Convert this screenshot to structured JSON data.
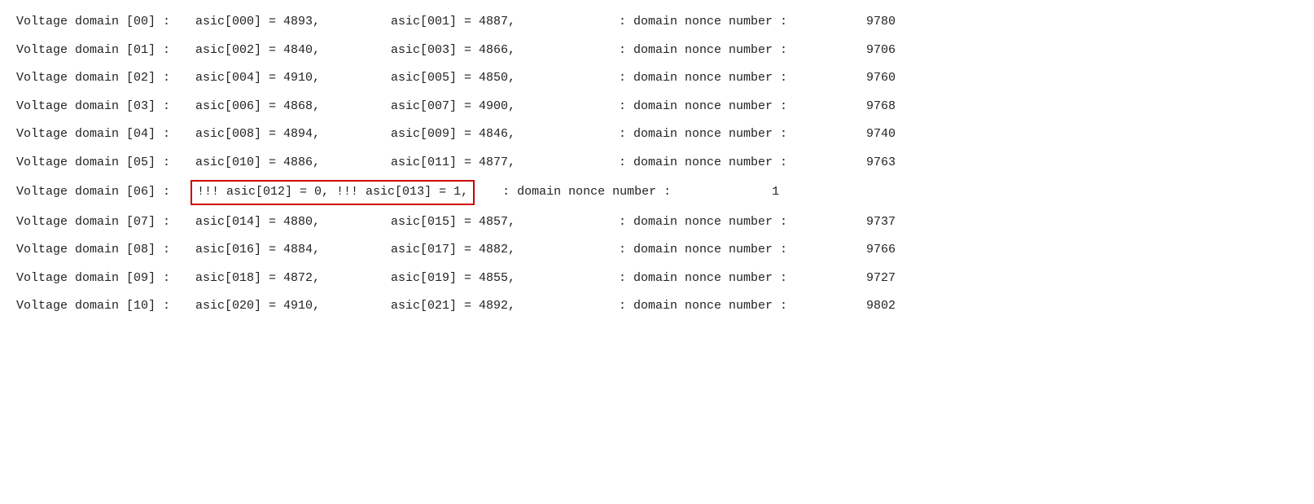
{
  "rows": [
    {
      "id": 0,
      "domain": "Voltage domain [00] :",
      "asic1_label": "asic[000]",
      "asic1_value": "4893",
      "asic2_label": "asic[001]",
      "asic2_value": "4887",
      "nonce_label": ": domain nonce number :",
      "nonce_value": "9780",
      "highlighted": false,
      "error": false
    },
    {
      "id": 1,
      "domain": "Voltage domain [01] :",
      "asic1_label": "asic[002]",
      "asic1_value": "4840",
      "asic2_label": "asic[003]",
      "asic2_value": "4866",
      "nonce_label": ": domain nonce number :",
      "nonce_value": "9706",
      "highlighted": false,
      "error": false
    },
    {
      "id": 2,
      "domain": "Voltage domain [02] :",
      "asic1_label": "asic[004]",
      "asic1_value": "4910",
      "asic2_label": "asic[005]",
      "asic2_value": "4850",
      "nonce_label": ": domain nonce number :",
      "nonce_value": "9760",
      "highlighted": false,
      "error": false
    },
    {
      "id": 3,
      "domain": "Voltage domain [03] :",
      "asic1_label": "asic[006]",
      "asic1_value": "4868",
      "asic2_label": "asic[007]",
      "asic2_value": "4900",
      "nonce_label": ": domain nonce number :",
      "nonce_value": "9768",
      "highlighted": false,
      "error": false
    },
    {
      "id": 4,
      "domain": "Voltage domain [04] :",
      "asic1_label": "asic[008]",
      "asic1_value": "4894",
      "asic2_label": "asic[009]",
      "asic2_value": "4846",
      "nonce_label": ": domain nonce number :",
      "nonce_value": "9740",
      "highlighted": false,
      "error": false
    },
    {
      "id": 5,
      "domain": "Voltage domain [05] :",
      "asic1_label": "asic[010]",
      "asic1_value": "4886",
      "asic2_label": "asic[011]",
      "asic2_value": "4877",
      "nonce_label": ": domain nonce number :",
      "nonce_value": "9763",
      "highlighted": false,
      "error": false
    },
    {
      "id": 6,
      "domain": "Voltage domain [06] :",
      "asic1_label": "asic[012]",
      "asic1_value": "0",
      "asic2_label": "asic[013]",
      "asic2_value": "1",
      "nonce_label": ": domain nonce number :",
      "nonce_value": "1",
      "highlighted": true,
      "error": true
    },
    {
      "id": 7,
      "domain": "Voltage domain [07] :",
      "asic1_label": "asic[014]",
      "asic1_value": "4880",
      "asic2_label": "asic[015]",
      "asic2_value": "4857",
      "nonce_label": ": domain nonce number :",
      "nonce_value": "9737",
      "highlighted": false,
      "error": false
    },
    {
      "id": 8,
      "domain": "Voltage domain [08] :",
      "asic1_label": "asic[016]",
      "asic1_value": "4884",
      "asic2_label": "asic[017]",
      "asic2_value": "4882",
      "nonce_label": ": domain nonce number :",
      "nonce_value": "9766",
      "highlighted": false,
      "error": false
    },
    {
      "id": 9,
      "domain": "Voltage domain [09] :",
      "asic1_label": "asic[018]",
      "asic1_value": "4872",
      "asic2_label": "asic[019]",
      "asic2_value": "4855",
      "nonce_label": ": domain nonce number :",
      "nonce_value": "9727",
      "highlighted": false,
      "error": false
    },
    {
      "id": 10,
      "domain": "Voltage domain [10] :",
      "asic1_label": "asic[020]",
      "asic1_value": "4910",
      "asic2_label": "asic[021]",
      "asic2_value": "4892",
      "nonce_label": ": domain nonce number :",
      "nonce_value": "9802",
      "highlighted": false,
      "error": false
    }
  ]
}
